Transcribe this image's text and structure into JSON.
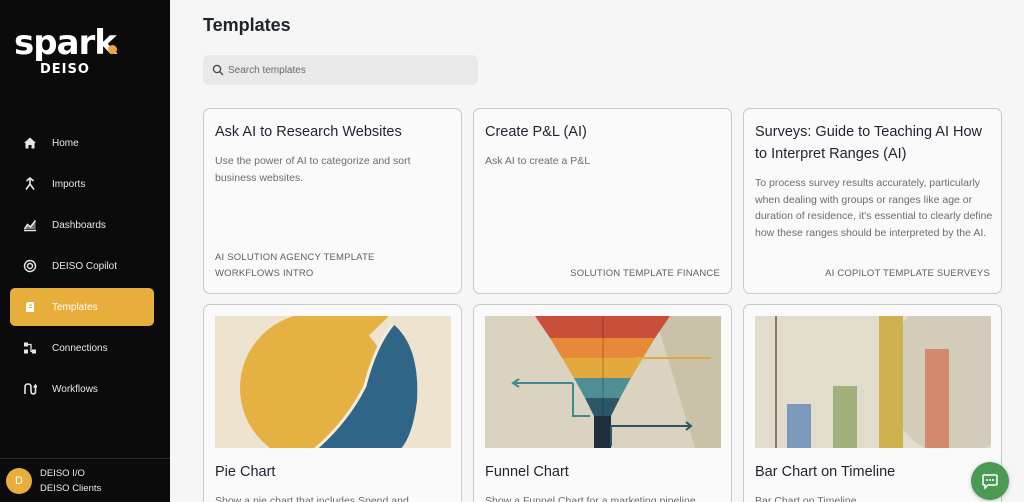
{
  "sidebar": {
    "logo_word": "spark",
    "logo_sub": "DEISO",
    "items": [
      {
        "label": "Home",
        "icon": "home-icon"
      },
      {
        "label": "Imports",
        "icon": "imports-icon"
      },
      {
        "label": "Dashboards",
        "icon": "dashboards-icon"
      },
      {
        "label": "DEISO Copilot",
        "icon": "copilot-icon"
      },
      {
        "label": "Templates",
        "icon": "templates-icon",
        "active": true
      },
      {
        "label": "Connections",
        "icon": "connections-icon"
      },
      {
        "label": "Workflows",
        "icon": "workflows-icon"
      }
    ],
    "user": {
      "initial": "D",
      "name": "DEISO I/O",
      "org": "DEISO Clients"
    }
  },
  "main": {
    "title": "Templates",
    "search_placeholder": "Search templates",
    "cards": [
      {
        "title": "Ask AI to Research Websites",
        "description": "Use the power of AI to categorize and sort business websites.",
        "tags": [
          "AI SOLUTION AGENCY TEMPLATE",
          "WORKFLOWS INTRO"
        ]
      },
      {
        "title": "Create P&L (AI)",
        "description": "Ask AI to create a P&L",
        "tags": [
          "SOLUTION TEMPLATE FINANCE"
        ]
      },
      {
        "title": "Surveys: Guide to Teaching AI How to Interpret Ranges (AI)",
        "description": "To process survey results accurately, particularly when dealing with groups or ranges like age or duration of residence, it's essential to clearly define how these ranges should be interpreted by the AI.",
        "tags": [
          "AI COPILOT TEMPLATE SUERVEYS"
        ]
      },
      {
        "title": "Pie Chart",
        "description": "Show a pie chart that includes Spend and",
        "image": "pie-chart-illustration"
      },
      {
        "title": "Funnel Chart",
        "description": "Show a Funnel Chart for a marketing pipeline",
        "image": "funnel-chart-illustration"
      },
      {
        "title": "Bar Chart on Timeline",
        "description": "Bar Chart on Timeline",
        "image": "bar-chart-illustration"
      }
    ]
  },
  "colors": {
    "sidebar_bg": "#0b0b0b",
    "accent": "#e8ae3c",
    "chat": "#4a9a52"
  }
}
